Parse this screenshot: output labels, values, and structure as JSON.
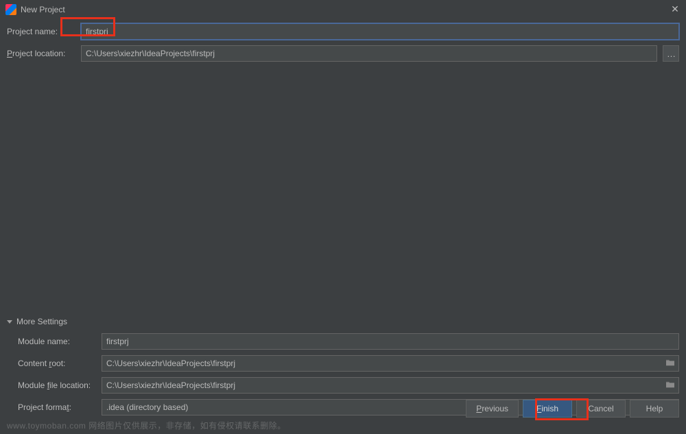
{
  "titlebar": {
    "title": "New Project"
  },
  "fields": {
    "project_name_label": "Project name:",
    "project_name_value": "firstprj",
    "project_location_label": "Project location:",
    "project_location_value": "C:\\Users\\xiezhr\\IdeaProjects\\firstprj"
  },
  "more_settings": {
    "header": "More Settings",
    "module_name_label": "Module name:",
    "module_name_value": "firstprj",
    "content_root_label": "Content root:",
    "content_root_value": "C:\\Users\\xiezhr\\IdeaProjects\\firstprj",
    "module_file_location_label": "Module file location:",
    "module_file_location_value": "C:\\Users\\xiezhr\\IdeaProjects\\firstprj",
    "project_format_label": "Project format:",
    "project_format_value": ".idea (directory based)"
  },
  "buttons": {
    "previous": "Previous",
    "finish": "Finish",
    "cancel": "Cancel",
    "help": "Help"
  },
  "watermark": "www.toymoban.com 网络图片仅供展示，非存储，如有侵权请联系删除。"
}
